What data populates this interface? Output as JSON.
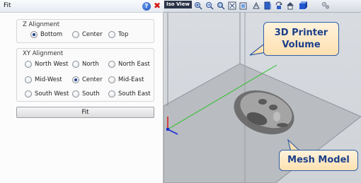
{
  "panel": {
    "title": "Fit",
    "help_icon": "help-icon",
    "close_icon": "close-icon",
    "close_glyph": "✖",
    "help_glyph": "?"
  },
  "z_alignment": {
    "title": "Z Alignment",
    "options": [
      "Bottom",
      "Center",
      "Top"
    ],
    "selected": "Bottom"
  },
  "xy_alignment": {
    "title": "XY Alignment",
    "options": [
      [
        "North West",
        "North",
        "North East"
      ],
      [
        "Mid-West",
        "Center",
        "Mid-East"
      ],
      [
        "South West",
        "South",
        "South East"
      ]
    ],
    "selected": "Center"
  },
  "fit_button": {
    "label": "Fit"
  },
  "viewport": {
    "view_tab": "Iso View",
    "toolbar_icons": [
      "zoom-in-icon",
      "zoom-out-icon",
      "zoom-window-icon",
      "zoom-fit-icon",
      "view-cube-icon",
      "perspective-icon",
      "front-view-icon",
      "rotate-icon",
      "home-icon",
      "solid-shading-icon",
      "settings-icon"
    ],
    "callout_volume_line1": "3D Printer",
    "callout_volume_line2": "Volume",
    "callout_mesh": "Mesh Model"
  },
  "colors": {
    "accent": "#1d3f8a",
    "callout_fill": "#fde0b0",
    "callout_border": "#2f5fa8",
    "axis_x": "#2ac02a",
    "axis_y": "#1b2fd8",
    "axis_z": "#d42020"
  }
}
